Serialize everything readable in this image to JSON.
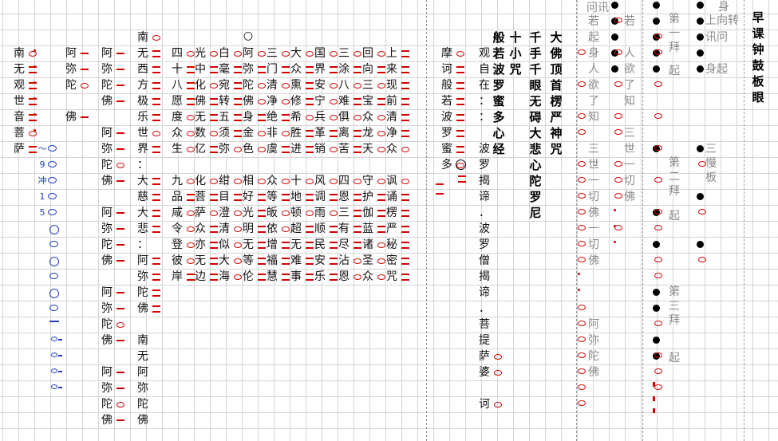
{
  "sheet": {
    "title": "早课钟鼓板眼",
    "columns": [
      {
        "id": "c1",
        "chars": [
          "南",
          "无",
          "观",
          "世",
          "音",
          "菩",
          "萨"
        ],
        "marks": [
          "o",
          "dbl",
          "dbl",
          "dbl",
          "dbl",
          "o",
          "dbl"
        ]
      },
      {
        "id": "c2",
        "chars": [
          "～",
          "9",
          "冲",
          "1",
          "5"
        ],
        "marks": [
          "",
          "",
          "",
          "",
          ""
        ]
      },
      {
        "id": "c3",
        "chars": [
          "阿",
          "弥",
          "陀",
          "",
          "佛"
        ],
        "marks": [
          "dash",
          "dash",
          "o",
          "",
          "dash"
        ]
      },
      {
        "id": "c4",
        "chars": [
          "阿",
          "弥",
          "陀",
          "佛",
          "",
          "阿",
          "弥",
          "陀",
          "佛",
          "",
          "阿",
          "弥",
          "陀",
          "佛",
          "",
          "阿",
          "弥",
          "陀",
          "佛",
          "",
          "阿",
          "弥",
          "陀",
          "佛"
        ],
        "marks": [
          "dash",
          "dash",
          "dash",
          "dash",
          "",
          "dash",
          "dash",
          "o",
          "dash",
          "",
          "dash",
          "dash",
          "dash",
          "dash",
          "",
          "dash",
          "dash",
          "o",
          "dash",
          "",
          "dash",
          "dash",
          "o",
          "dash"
        ]
      },
      {
        "id": "c5",
        "chars": [
          "南",
          "无",
          "西",
          "方",
          "极",
          "乐",
          "世",
          "界",
          "：",
          "大",
          "慈",
          "大",
          "悲",
          "：",
          "阿",
          "弥",
          "陀",
          "佛",
          "",
          "南",
          "无",
          "阿",
          "弥",
          "陀",
          "佛"
        ],
        "marks": [
          "o",
          "dbl",
          "dbl",
          "dbl",
          "dbl",
          "dbl",
          "o",
          "dbl",
          "",
          "dbl",
          "dbl",
          "dbl",
          "dbl",
          "",
          "dbl",
          "dbl",
          "dbl",
          "dbl",
          "",
          "",
          "",
          "",
          "",
          "",
          ""
        ]
      },
      {
        "id": "c6",
        "chars": [
          "四",
          "十",
          "八",
          "愿",
          "度",
          "众",
          "生",
          "",
          "九",
          "品",
          "咸",
          "令",
          "登",
          "彼",
          "岸"
        ],
        "marks": [
          "o",
          "dbl",
          "dbl",
          "dbl",
          "o",
          "o",
          "o",
          "",
          "o",
          "dbl",
          "o",
          "o",
          "o",
          "o",
          "dbl"
        ]
      },
      {
        "id": "c7",
        "chars": [
          "光",
          "中",
          "化",
          "佛",
          "无",
          "数",
          "亿",
          "",
          "化",
          "菩",
          "萨",
          "众",
          "亦",
          "无",
          "边"
        ],
        "marks": [
          "o",
          "dbl",
          "o",
          "dbl",
          "dbl",
          "o",
          "dbl",
          "",
          "o",
          "dbl",
          "o",
          "dbl",
          "dbl",
          "dbl",
          "dbl"
        ]
      },
      {
        "id": "c8",
        "chars": [
          "白",
          "毫",
          "宛",
          "转",
          "五",
          "须",
          "弥",
          "",
          "绀",
          "目",
          "澄",
          "清",
          "似",
          "大",
          "海"
        ],
        "marks": [
          "o",
          "dbl",
          "dbl",
          "dbl",
          "dbl",
          "dbl",
          "o",
          "",
          "o",
          "dbl",
          "o",
          "o",
          "o",
          "o",
          "o"
        ]
      },
      {
        "id": "c9",
        "chars": [
          "阿",
          "弥",
          "陀",
          "佛",
          "身",
          "金",
          "色",
          "",
          "相",
          "好",
          "光",
          "明",
          "无",
          "等",
          "伦"
        ],
        "marks": [
          "o",
          "dbl",
          "o",
          "o",
          "dbl",
          "o",
          "o",
          "",
          "o",
          "dbl",
          "dbl",
          "dbl",
          "dbl",
          "dbl",
          "dbl"
        ]
      },
      {
        "id": "c10",
        "chars": [
          "三",
          "门",
          "清",
          "净",
          "绝",
          "非",
          "虞",
          "",
          "众",
          "等",
          "皈",
          "依",
          "增",
          "福",
          "慧"
        ],
        "marks": [
          "o",
          "dbl",
          "o",
          "o",
          "dbl",
          "o",
          "dbl",
          "",
          "o",
          "dbl",
          "o",
          "o",
          "dbl",
          "dbl",
          "dbl"
        ]
      },
      {
        "id": "c11",
        "chars": [
          "大",
          "众",
          "熏",
          "修",
          "希",
          "胜",
          "进",
          "",
          "十",
          "地",
          "顿",
          "超",
          "无",
          "难",
          "事"
        ],
        "marks": [
          "o",
          "dbl",
          "dbl",
          "dbl",
          "o",
          "dbl",
          "dbl",
          "",
          "o",
          "dbl",
          "o",
          "dbl",
          "dbl",
          "dbl",
          "dbl"
        ]
      },
      {
        "id": "c12",
        "chars": [
          "国",
          "界",
          "安",
          "宁",
          "兵",
          "革",
          "销",
          "",
          "风",
          "调",
          "雨",
          "顺",
          "民",
          "安",
          "乐"
        ],
        "marks": [
          "o",
          "dbl",
          "o",
          "o",
          "o",
          "dbl",
          "o",
          "",
          "o",
          "dbl",
          "o",
          "dbl",
          "dbl",
          "dbl",
          "dbl"
        ]
      },
      {
        "id": "c13",
        "chars": [
          "三",
          "涂",
          "八",
          "难",
          "俱",
          "离",
          "苦",
          "",
          "四",
          "恩",
          "三",
          "有",
          "尽",
          "沾",
          "恩"
        ],
        "marks": [
          "o",
          "dbl",
          "o",
          "dbl",
          "o",
          "dbl",
          "dbl",
          "",
          "o",
          "dbl",
          "dbl",
          "dbl",
          "dbl",
          "o",
          "o"
        ]
      },
      {
        "id": "c14",
        "chars": [
          "回",
          "向",
          "三",
          "宝",
          "众",
          "龙",
          "天",
          "",
          "守",
          "护",
          "伽",
          "蓝",
          "诸",
          "圣",
          "众"
        ],
        "marks": [
          "o",
          "dbl",
          "o",
          "dbl",
          "o",
          "o",
          "o",
          "",
          "o",
          "dbl",
          "dbl",
          "dbl",
          "o",
          "o",
          "o"
        ]
      },
      {
        "id": "c15",
        "chars": [
          "上",
          "来",
          "现",
          "前",
          "清",
          "净",
          "众",
          "",
          "讽",
          "诵",
          "楞",
          "严",
          "秘",
          "密",
          "咒"
        ],
        "marks": [
          "dbl",
          "dbl",
          "dbl",
          "dbl",
          "dbl",
          "dbl",
          "o",
          "",
          "o",
          "dbl",
          "dbl",
          "dbl",
          "dbl",
          "dbl",
          "dbl"
        ]
      },
      {
        "id": "c16",
        "chars": [
          "摩",
          "诃",
          "般",
          "若",
          "波",
          "罗",
          "蜜",
          "多"
        ],
        "marks": [
          "o",
          "dbl",
          "dbl",
          "dbl",
          "dbl",
          "dbl",
          "dbl",
          "o"
        ]
      },
      {
        "id": "c17",
        "chars": [
          "观",
          "自",
          "在",
          "：",
          "：",
          "",
          "波",
          "罗",
          "揭",
          "谛",
          "．",
          "波",
          "罗",
          "僧",
          "揭",
          "谛",
          "．",
          "菩",
          "提",
          "萨",
          "婆",
          "",
          "诃"
        ],
        "marks": [
          "",
          "",
          "",
          "",
          "",
          "",
          "",
          "",
          "",
          "",
          "",
          "",
          "",
          "",
          "",
          "",
          "",
          "",
          "",
          "o",
          "o",
          "",
          "o"
        ]
      },
      {
        "id": "c18",
        "chars": [
          "般",
          "若",
          "波",
          "罗",
          "蜜",
          "多",
          "心",
          "经"
        ],
        "marks": []
      },
      {
        "id": "c19",
        "chars": [
          "十",
          "小",
          "咒"
        ],
        "marks": []
      },
      {
        "id": "c20",
        "chars": [
          "千",
          "手",
          "千",
          "眼",
          "无",
          "碍",
          "大",
          "悲",
          "心",
          "陀",
          "罗",
          "尼"
        ],
        "marks": []
      },
      {
        "id": "c21",
        "chars": [
          "大",
          "佛",
          "顶",
          "首",
          "楞",
          "严",
          "神",
          "咒"
        ],
        "marks": []
      }
    ],
    "gray_columns": [
      {
        "id": "g1",
        "chars": [
          "问",
          "讯"
        ]
      },
      {
        "id": "g2",
        "chars": [
          "若",
          "起",
          "身",
          "人",
          "欲",
          "了",
          "知",
          "",
          "三",
          "世",
          "一",
          "切",
          "佛",
          "一",
          "切",
          "佛",
          "",
          "",
          "",
          "阿",
          "弥",
          "陀",
          "佛"
        ]
      },
      {
        "id": "g3",
        "chars": [
          "若",
          "",
          "人",
          "欲",
          "了",
          "知",
          "",
          "三",
          "世",
          "一",
          "切",
          "佛"
        ]
      }
    ],
    "notes": [
      {
        "id": "n1",
        "text": "第一拜"
      },
      {
        "id": "n2",
        "text": "起"
      },
      {
        "id": "n3",
        "text": "第二拜"
      },
      {
        "id": "n4",
        "text": "起"
      },
      {
        "id": "n5",
        "text": "第三拜"
      },
      {
        "id": "n6",
        "text": "起"
      },
      {
        "id": "n7",
        "text": "身"
      },
      {
        "id": "n8",
        "text": "上向转"
      },
      {
        "id": "n9",
        "text": "讯问"
      },
      {
        "id": "n10",
        "text": "身起"
      },
      {
        "id": "n11",
        "text": "三慢板"
      }
    ],
    "top_mark": "○"
  }
}
